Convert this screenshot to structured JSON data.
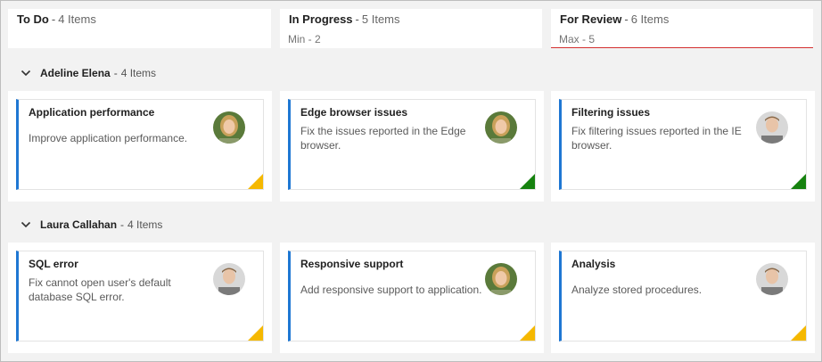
{
  "columns": [
    {
      "title": "To Do",
      "count": "4 Items",
      "limit": ""
    },
    {
      "title": "In Progress",
      "count": "5 Items",
      "limit": "Min - 2"
    },
    {
      "title": "For Review",
      "count": "6 Items",
      "limit": "Max - 5"
    }
  ],
  "lanes": [
    {
      "name": "Adeline Elena",
      "count": "4 Items",
      "cards": [
        {
          "title": "Application performance",
          "desc": "Improve application performance.",
          "priority": "yellow",
          "avatar": "female-avatar"
        },
        {
          "title": "Edge browser issues",
          "desc": "Fix the issues reported in the Edge browser.",
          "priority": "green",
          "avatar": "female-avatar"
        },
        {
          "title": "Filtering issues",
          "desc": "Fix filtering issues reported in the IE browser.",
          "priority": "green",
          "avatar": "male-avatar"
        }
      ]
    },
    {
      "name": "Laura Callahan",
      "count": "4 Items",
      "cards": [
        {
          "title": "SQL error",
          "desc": "Fix cannot open user's default database SQL error.",
          "priority": "yellow",
          "avatar": "male-avatar"
        },
        {
          "title": "Responsive support",
          "desc": "Add responsive support to application.",
          "priority": "yellow",
          "avatar": "female-avatar"
        },
        {
          "title": "Analysis",
          "desc": "Analyze stored procedures.",
          "priority": "yellow",
          "avatar": "male-avatar"
        }
      ]
    }
  ],
  "colors": {
    "card_accent": "#1e77d3",
    "priority_yellow": "#f5b800",
    "priority_green": "#16820f",
    "wip_alert": "#d32f2f"
  },
  "separator": "-"
}
